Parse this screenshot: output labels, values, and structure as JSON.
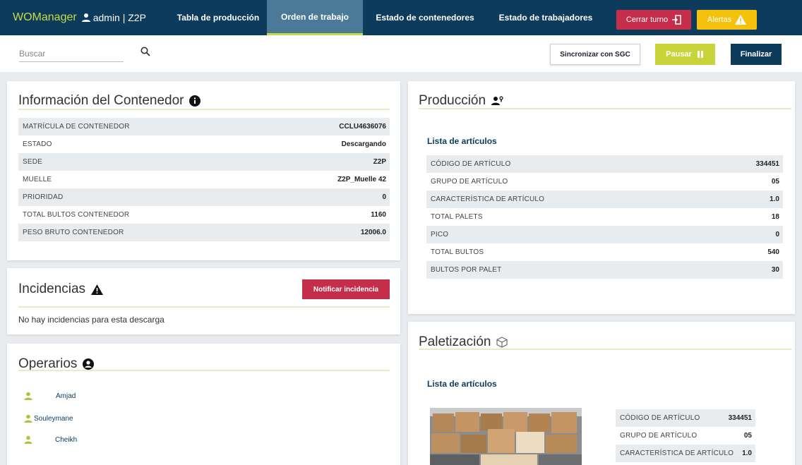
{
  "app": {
    "brand": "WOManager",
    "user": "admin | Z2P"
  },
  "nav": {
    "tabs": [
      {
        "label": "Tabla de producción"
      },
      {
        "label": "Orden de trabajo"
      },
      {
        "label": "Estado de contenedores"
      },
      {
        "label": "Estado de trabajadores"
      }
    ],
    "active_tab": "Orden de trabajo",
    "cerrar_turno": "Cerrar turno",
    "alertas": "Alertas"
  },
  "toolbar": {
    "search_placeholder": "Buscar",
    "sync_label": "Sincronizar con SGC",
    "pausar_label": "Pausar",
    "finalizar_label": "Finalizar"
  },
  "contenedor": {
    "title": "Información del Contenedor",
    "rows": [
      {
        "key": "MATRÍCULA DE CONTENEDOR",
        "value": "CCLU4636076"
      },
      {
        "key": "ESTADO",
        "value": "Descargando"
      },
      {
        "key": "SEDE",
        "value": "Z2P"
      },
      {
        "key": "MUELLE",
        "value": "Z2P_Muelle 42"
      },
      {
        "key": "PRIORIDAD",
        "value": "0"
      },
      {
        "key": "TOTAL BULTOS CONTENEDOR",
        "value": "1160"
      },
      {
        "key": "PESO BRUTO CONTENEDOR",
        "value": "12006.0"
      }
    ]
  },
  "incidencias": {
    "title": "Incidencias",
    "button": "Notificar incidencia",
    "empty_text": "No hay incidencias para esta descarga"
  },
  "operarios": {
    "title": "Operarios",
    "items": [
      {
        "name": "Amjad"
      },
      {
        "name": "Souleymane"
      },
      {
        "name": "Cheikh"
      }
    ]
  },
  "produccion": {
    "title": "Producción",
    "list_title": "Lista de artículos",
    "rows": [
      {
        "key": "CÓDIGO DE ARTÍCULO",
        "value": "334451"
      },
      {
        "key": "GRUPO DE ARTÍCULO",
        "value": "05"
      },
      {
        "key": "CARACTERÍSTICA DE ARTÍCULO",
        "value": "1.0"
      },
      {
        "key": "TOTAL PALETS",
        "value": "18"
      },
      {
        "key": "PICO",
        "value": "0"
      },
      {
        "key": "TOTAL BULTOS",
        "value": "540"
      },
      {
        "key": "BULTOS POR PALET",
        "value": "30"
      }
    ]
  },
  "paletizacion": {
    "title": "Paletización",
    "list_title": "Lista de artículos",
    "rows": [
      {
        "key": "CÓDIGO DE ARTÍCULO",
        "value": "334451"
      },
      {
        "key": "GRUPO DE ARTÍCULO",
        "value": "05"
      },
      {
        "key": "CARACTERÍSTICA DE ARTÍCULO",
        "value": "1.0"
      }
    ]
  },
  "colors": {
    "navy": "#0d3b5c",
    "lime": "#c8d94a",
    "red": "#c42e4b",
    "yellow": "#f4c20d"
  }
}
